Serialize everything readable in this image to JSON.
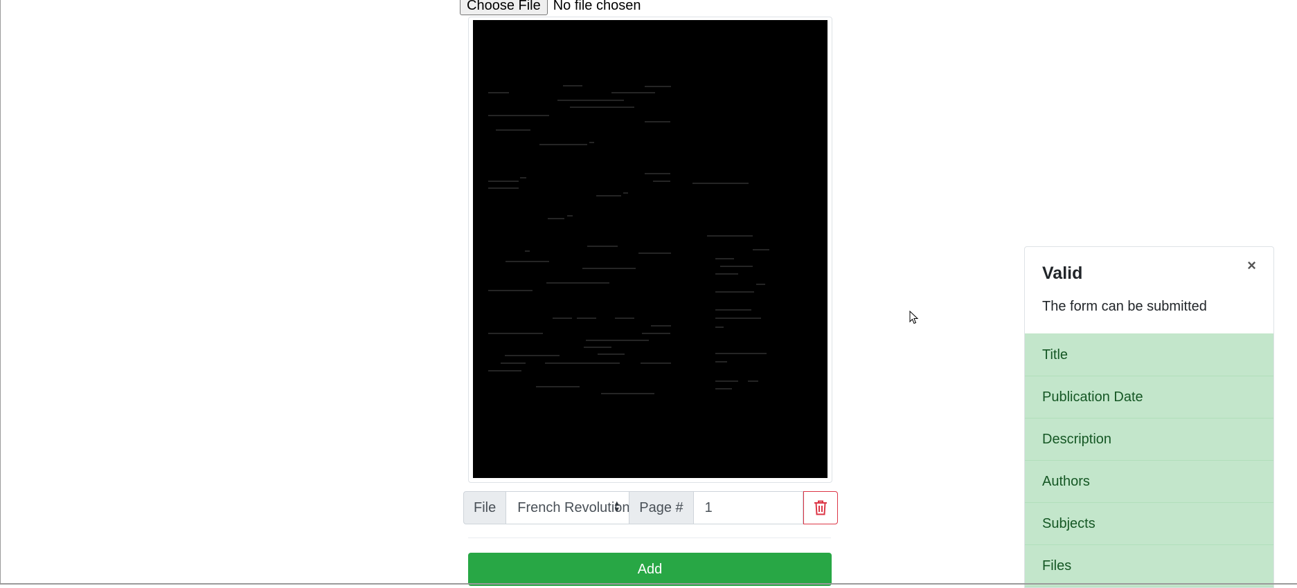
{
  "file_input": {
    "button_label": "Choose File",
    "status": "No file chosen"
  },
  "page_row": {
    "file_label": "File",
    "file_select_value": "French Revolution",
    "page_label": "Page #",
    "page_value": "1"
  },
  "add_button": {
    "label": "Add"
  },
  "validation": {
    "title": "Valid",
    "close_symbol": "×",
    "message": "The form can be submitted",
    "fields": [
      "Title",
      "Publication Date",
      "Description",
      "Authors",
      "Subjects",
      "Files"
    ]
  },
  "icons": {
    "delete": "trash-icon",
    "select_caret": "sort-caret-icon",
    "cursor": "mouse-pointer-icon"
  },
  "colors": {
    "success": "#28a745",
    "success_light": "#c3e6cb",
    "success_text": "#155724",
    "danger": "#dc3545"
  }
}
